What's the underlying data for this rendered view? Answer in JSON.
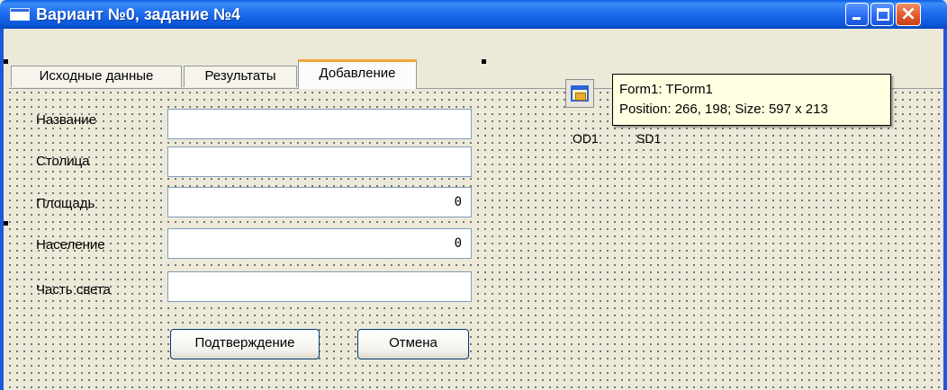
{
  "window": {
    "title": "Вариант №0, задание №4"
  },
  "tabs": [
    {
      "label": "Исходные данные"
    },
    {
      "label": "Результаты"
    },
    {
      "label": "Добавление",
      "active": true
    }
  ],
  "form": {
    "name_label": "Название",
    "capital_label": "Столица",
    "area_label": "Площадь",
    "area_value": "0",
    "population_label": "Население",
    "population_value": "0",
    "continent_label": "Часть света"
  },
  "buttons": {
    "confirm": "Подтверждение",
    "cancel": "Отмена"
  },
  "components": {
    "od1": "OD1",
    "sd1": "SD1"
  },
  "tooltip": {
    "line1": "Form1: TForm1",
    "line2": "Position: 266, 198; Size: 597 x 213"
  },
  "colors": {
    "titlebar": "#0a58d8",
    "tab_accent": "#f3a83c",
    "tooltip_bg": "#ffffe1"
  }
}
